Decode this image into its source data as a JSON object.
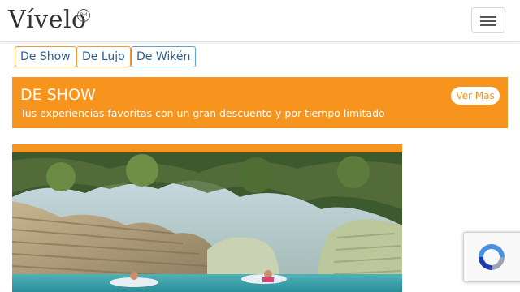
{
  "header": {
    "brand": "Vívelo",
    "brand_mark": "PM",
    "menu_icon": "hamburger-icon"
  },
  "filters": [
    {
      "label": "De Show"
    },
    {
      "label": "De Lujo"
    },
    {
      "label": "De Wikén"
    }
  ],
  "banner": {
    "title": "DE SHOW",
    "subtitle": "Tus experiencias favoritas con un gran descuento y por tiempo limitado",
    "button_label": "Ver Más"
  },
  "card": {
    "image_icon": "river-canyon-photo"
  },
  "recaptcha": {
    "icon": "recaptcha-icon"
  },
  "colors": {
    "accent": "#f7941e",
    "chip_text": "#2d5d8a",
    "chip_border_alt": "#5aa6d4"
  }
}
